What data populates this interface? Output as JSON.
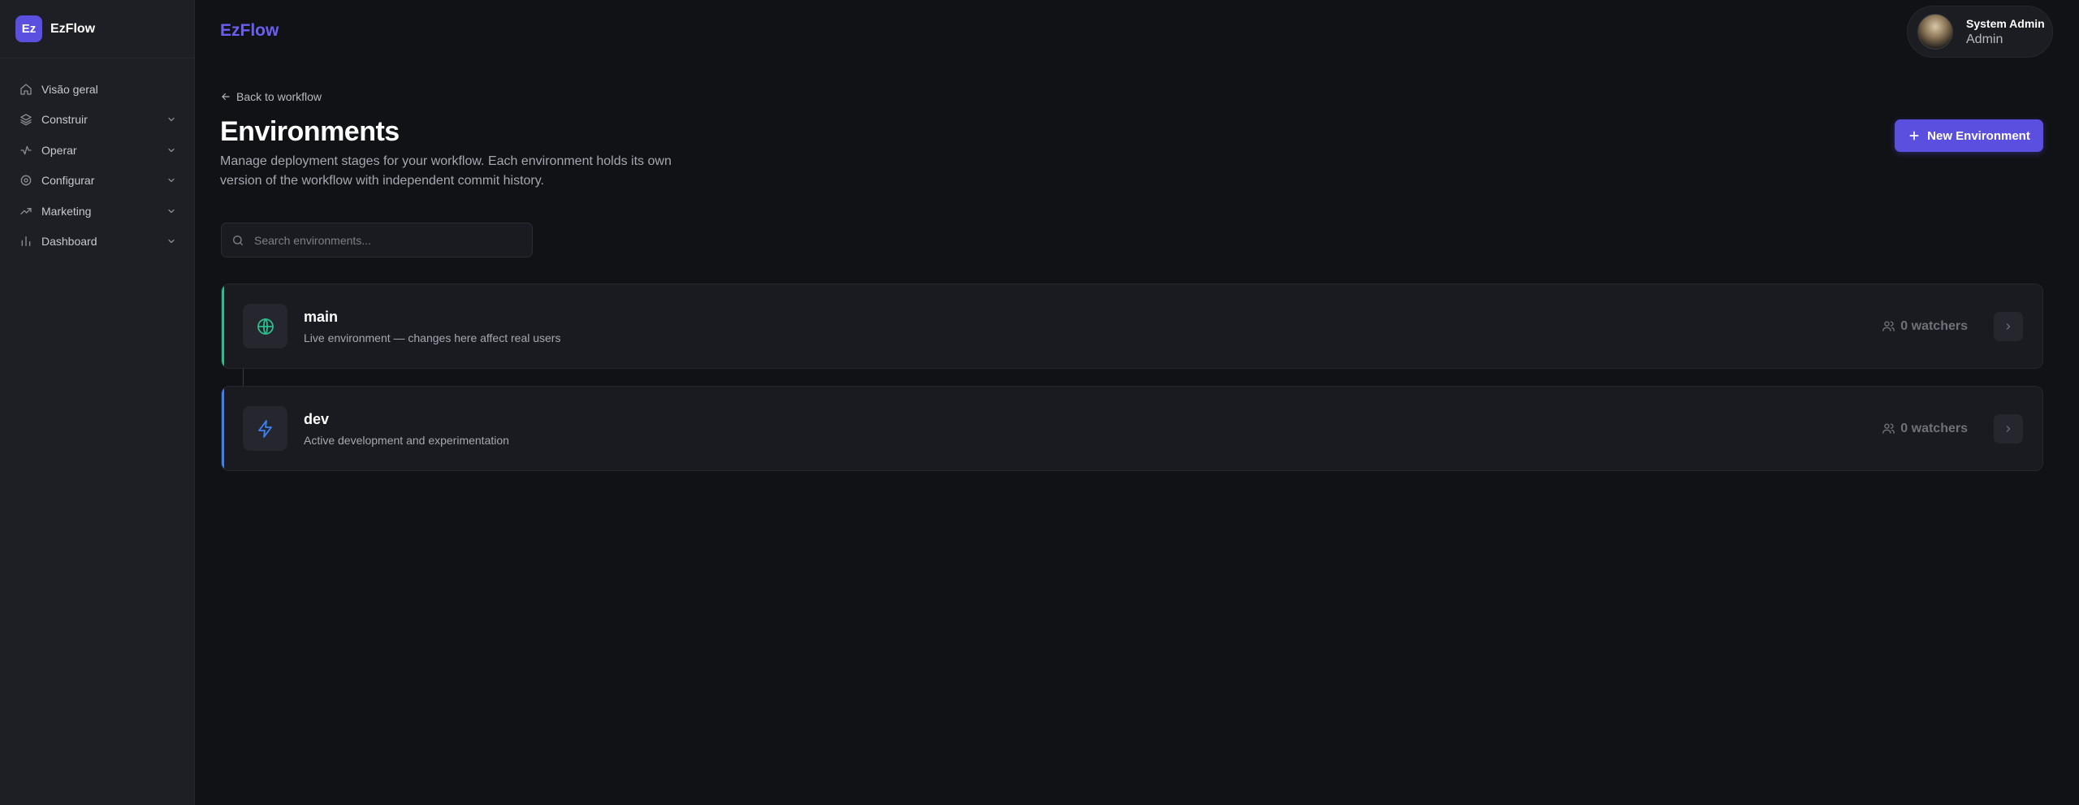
{
  "brand": {
    "logo_text": "Ez",
    "name": "EzFlow"
  },
  "sidebar": {
    "items": [
      {
        "label": "Visão geral",
        "icon": "home-icon",
        "has_chevron": false
      },
      {
        "label": "Construir",
        "icon": "layers-icon",
        "has_chevron": true
      },
      {
        "label": "Operar",
        "icon": "activity-icon",
        "has_chevron": true
      },
      {
        "label": "Configurar",
        "icon": "gear-icon",
        "has_chevron": true
      },
      {
        "label": "Marketing",
        "icon": "trending-up-icon",
        "has_chevron": true
      },
      {
        "label": "Dashboard",
        "icon": "bar-chart-icon",
        "has_chevron": true
      }
    ]
  },
  "topbar": {
    "title": "EzFlow"
  },
  "user": {
    "name": "System Admin",
    "role": "Admin"
  },
  "header": {
    "back_label": "Back to workflow",
    "title": "Environments",
    "description": "Manage deployment stages for your workflow. Each environment holds its own version of the workflow with independent commit history.",
    "new_button_label": "New Environment"
  },
  "search": {
    "placeholder": "Search environments..."
  },
  "environments": [
    {
      "name": "main",
      "description": "Live environment — changes here affect real users",
      "watchers": "0 watchers",
      "icon": "globe-icon",
      "accent": "#2bbf8e"
    },
    {
      "name": "dev",
      "description": "Active development and experimentation",
      "watchers": "0 watchers",
      "icon": "zap-icon",
      "accent": "#3b82f6"
    }
  ],
  "colors": {
    "accent": "#5b4fe0",
    "brand_title": "#6a5ff0",
    "background": "#111216",
    "sidebar": "#1e1f25"
  }
}
